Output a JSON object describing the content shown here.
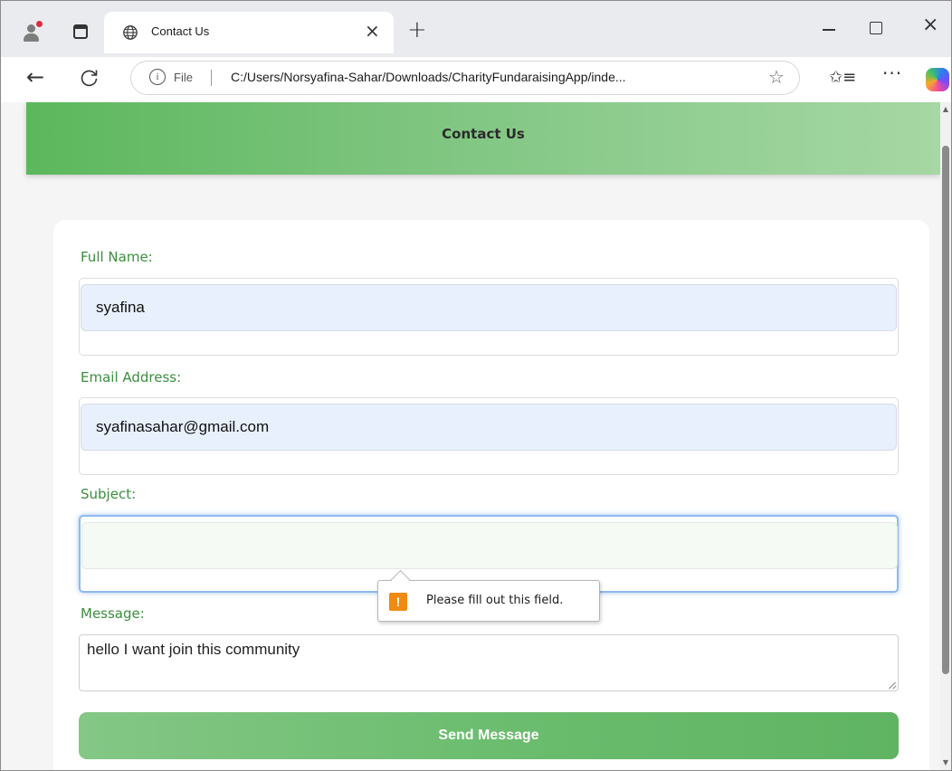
{
  "browser": {
    "tab_title": "Contact Us",
    "tab_close": "×",
    "new_tab": "+",
    "address_info": "i",
    "address_prefix": "File",
    "address_url": "C:/Users/Norsyafina-Sahar/Downloads/CharityFundaraisingApp/inde...",
    "more_label": "···",
    "icons": {
      "profile": "profile-icon",
      "tabs": "tab-actions-icon",
      "globe": "globe-icon",
      "back": "back-arrow-icon",
      "refresh": "refresh-icon",
      "info": "info-icon",
      "star": "star-icon",
      "favorites": "favorites-icon",
      "more": "more-icon",
      "copilot": "copilot-icon"
    }
  },
  "window_controls": {
    "minimize": "minimize-icon",
    "maximize": "maximize-icon",
    "close_glyph": "×"
  },
  "page": {
    "header_title": "Contact Us",
    "accent_color": "#5cb85c",
    "label_color": "#3b8e3e"
  },
  "form": {
    "full_name": {
      "label": "Full Name:",
      "value": "syafina"
    },
    "email": {
      "label": "Email Address:",
      "value": "syafinasahar@gmail.com"
    },
    "subject": {
      "label": "Subject:",
      "value": ""
    },
    "message": {
      "label": "Message:",
      "value": "hello I want join this community"
    },
    "submit_label": "Send Message"
  },
  "validation_tooltip": {
    "icon": "!",
    "text": "Please fill out this field."
  }
}
